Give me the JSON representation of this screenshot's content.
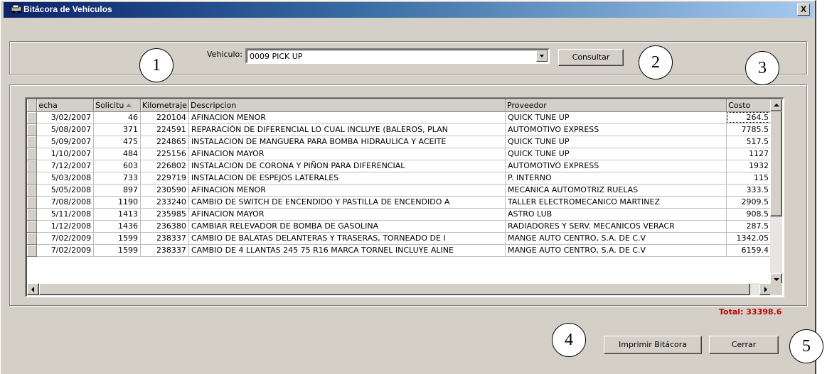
{
  "window": {
    "title": "Bitácora de Vehículos",
    "close_label": "X"
  },
  "filter": {
    "vehicle_label": "Vehiculo:",
    "vehicle_value": "0009 PICK UP",
    "consult_button": "Consultar"
  },
  "callouts": [
    "1",
    "2",
    "3",
    "4",
    "5"
  ],
  "table": {
    "columns": [
      "echa",
      "Solicitu",
      "Kilometraje",
      "Descripcion",
      "Proveedor",
      "Costo"
    ],
    "rows": [
      [
        "3/02/2007",
        "46",
        "220104",
        "AFINACION MENOR",
        "QUICK TUNE UP",
        "264.5"
      ],
      [
        "5/08/2007",
        "371",
        "224591",
        "REPARACIÓN DE DIFERENCIAL LO CUAL INCLUYE (BALEROS, PLAN",
        "AUTOMOTIVO EXPRESS",
        "7785.5"
      ],
      [
        "5/09/2007",
        "475",
        "224865",
        "INSTALACION DE MANGUERA PARA BOMBA HIDRAULICA Y ACEITE",
        "QUICK TUNE UP",
        "517.5"
      ],
      [
        "1/10/2007",
        "484",
        "225156",
        "AFINACION MAYOR",
        "QUICK TUNE UP",
        "1127"
      ],
      [
        "7/12/2007",
        "603",
        "226802",
        "INSTALACION DE CORONA Y PIÑON PARA DIFERENCIAL",
        "AUTOMOTIVO EXPRESS",
        "1932"
      ],
      [
        "5/03/2008",
        "733",
        "229719",
        "INSTALACION DE ESPEJOS LATERALES",
        "P. INTERNO",
        "115"
      ],
      [
        "5/05/2008",
        "897",
        "230590",
        "AFINACION MENOR",
        "MECANICA AUTOMOTRIZ RUELAS",
        "333.5"
      ],
      [
        "7/08/2008",
        "1190",
        "233240",
        "CAMBIO DE SWITCH DE ENCENDIDO Y PASTILLA DE ENCENDIDO A",
        "TALLER ELECTROMECANICO MARTINEZ",
        "2909.5"
      ],
      [
        "5/11/2008",
        "1413",
        "235985",
        "AFINACION MAYOR",
        "ASTRO LUB",
        "908.5"
      ],
      [
        "1/12/2008",
        "1436",
        "236380",
        "CAMBIAR RELEVADOR DE BOMBA DE GASOLINA",
        "RADIADORES Y SERV. MECANICOS VERACR",
        "287.5"
      ],
      [
        "7/02/2009",
        "1599",
        "238337",
        "CAMBIO DE BALATAS DELANTERAS Y TRASERAS, TORNEADO DE I",
        "MANGE AUTO CENTRO, S.A. DE C.V",
        "1342.05"
      ],
      [
        "7/02/2009",
        "1599",
        "238337",
        "CAMBIO DE 4 LLANTAS 245 75 R16 MARCA TORNEL INCLUYE ALINE",
        "MANGE AUTO CENTRO, S.A. DE C.V",
        "6159.4"
      ]
    ]
  },
  "footer": {
    "total": "Total: 33398.6",
    "print_button": "Imprimir Bitácora",
    "close_button": "Cerrar"
  }
}
